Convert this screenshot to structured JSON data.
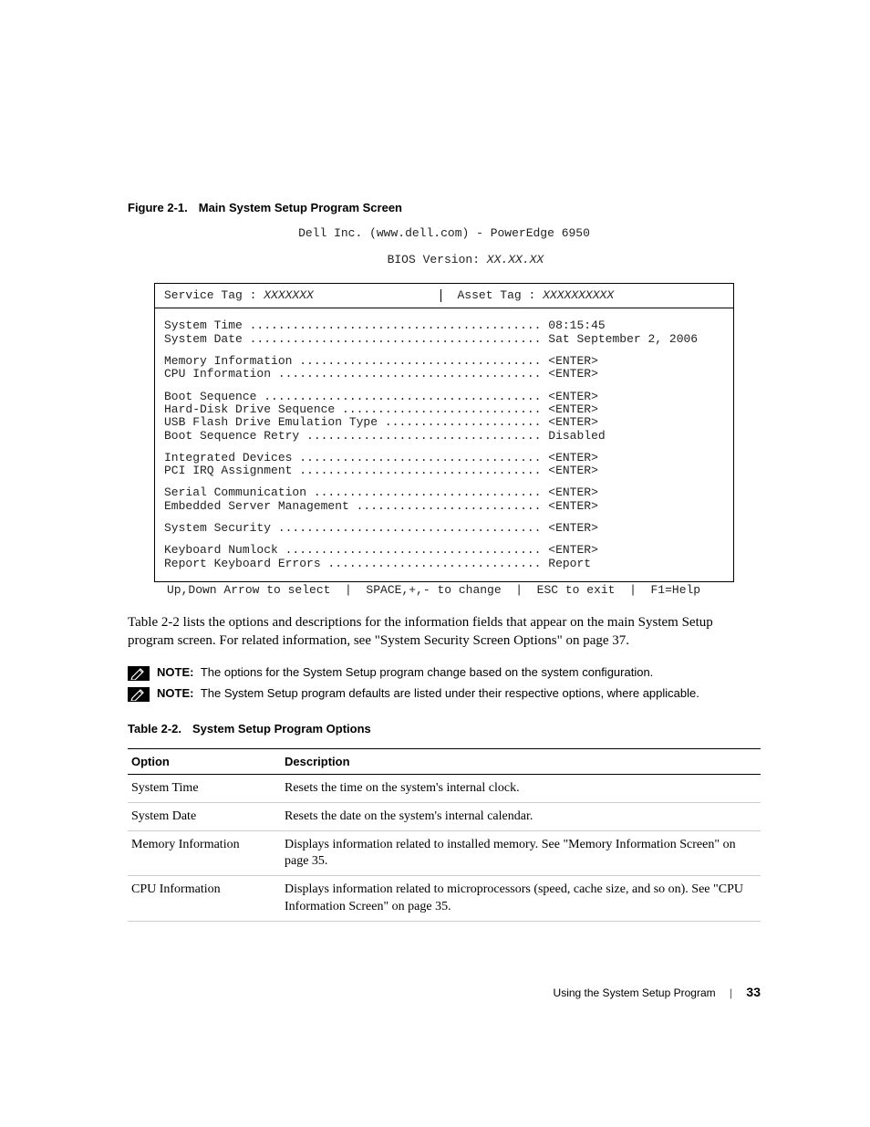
{
  "figure": {
    "label": "Figure 2-1.",
    "title": "Main System Setup Program Screen"
  },
  "bios": {
    "header_line": "Dell Inc. (www.dell.com) - PowerEdge 6950",
    "subheader_prefix": "BIOS Version: ",
    "subheader_version": "XX.XX.XX",
    "service_tag_label": "Service Tag : ",
    "service_tag_value": "XXXXXXX",
    "asset_tag_label": "Asset Tag : ",
    "asset_tag_value": "XXXXXXXXXX",
    "groups": [
      [
        {
          "label": "System Time",
          "value": "08:15:45"
        },
        {
          "label": "System Date",
          "value": "Sat September 2, 2006"
        }
      ],
      [
        {
          "label": "Memory Information",
          "value": "<ENTER>"
        },
        {
          "label": "CPU Information",
          "value": "<ENTER>"
        }
      ],
      [
        {
          "label": "Boot Sequence",
          "value": "<ENTER>"
        },
        {
          "label": "Hard-Disk Drive Sequence",
          "value": "<ENTER>"
        },
        {
          "label": "USB Flash Drive Emulation Type",
          "value": "<ENTER>"
        },
        {
          "label": "Boot Sequence Retry",
          "value": "Disabled"
        }
      ],
      [
        {
          "label": "Integrated Devices",
          "value": "<ENTER>"
        },
        {
          "label": "PCI IRQ Assignment",
          "value": "<ENTER>"
        }
      ],
      [
        {
          "label": "Serial Communication",
          "value": "<ENTER>"
        },
        {
          "label": "Embedded Server Management",
          "value": "<ENTER>"
        }
      ],
      [
        {
          "label": "System Security",
          "value": "<ENTER>"
        }
      ],
      [
        {
          "label": "Keyboard Numlock",
          "value": "<ENTER>"
        },
        {
          "label": "Report Keyboard Errors",
          "value": "Report"
        }
      ]
    ],
    "footer": "Up,Down Arrow to select  |  SPACE,+,- to change  |  ESC to exit  |  F1=Help"
  },
  "paragraph": "Table 2-2 lists the options and descriptions for the information fields that appear on the main System Setup program screen. For related information, see \"System Security Screen Options\" on page 37.",
  "notes": {
    "label": "NOTE:",
    "items": [
      "The options for the System Setup program change based on the system configuration.",
      "The System Setup program defaults are listed under their respective options, where applicable."
    ]
  },
  "table": {
    "label": "Table 2-2.",
    "title": "System Setup Program Options",
    "headers": {
      "option": "Option",
      "description": "Description"
    },
    "rows": [
      {
        "option": "System Time",
        "description": "Resets the time on the system's internal clock."
      },
      {
        "option": "System Date",
        "description": "Resets the date on the system's internal calendar."
      },
      {
        "option": "Memory Information",
        "description": "Displays information related to installed memory. See \"Memory Information Screen\" on page 35."
      },
      {
        "option": "CPU Information",
        "description": "Displays information related to microprocessors (speed, cache size, and so on). See \"CPU Information Screen\" on page 35."
      }
    ]
  },
  "page_footer": {
    "section": "Using the System Setup Program",
    "page_number": "33"
  }
}
